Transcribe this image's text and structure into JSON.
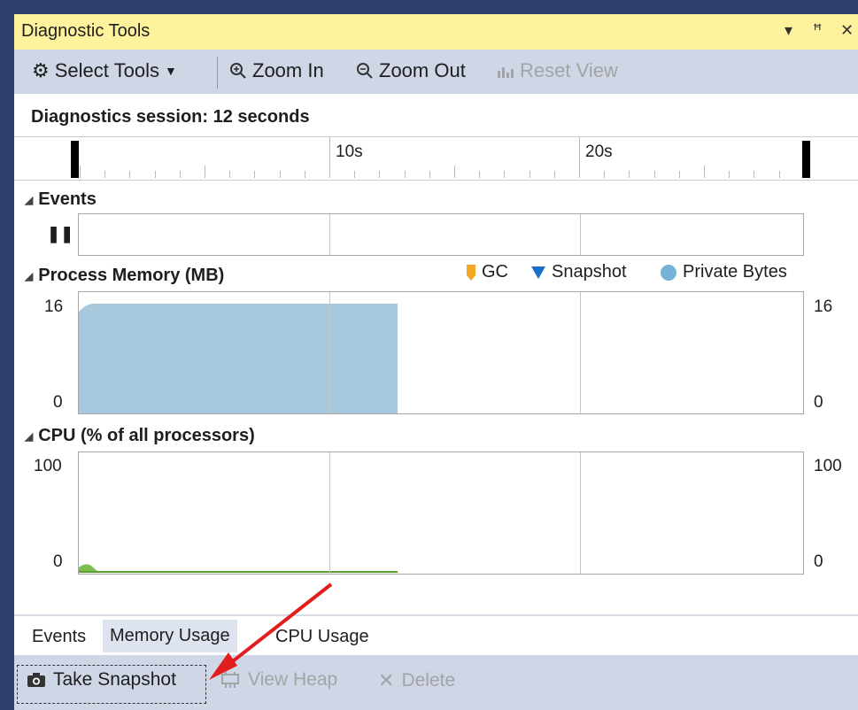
{
  "window": {
    "title": "Diagnostic Tools",
    "controls": [
      "▾",
      "ꟸ",
      "✕"
    ]
  },
  "toolbar": {
    "select_tools": "Select Tools",
    "zoom_in": "Zoom In",
    "zoom_out": "Zoom Out",
    "reset_view": "Reset View"
  },
  "session": {
    "label": "Diagnostics session: 12 seconds"
  },
  "ruler": {
    "labels": [
      "10s",
      "20s"
    ]
  },
  "events": {
    "title": "Events"
  },
  "memory": {
    "title": "Process Memory (MB)",
    "legend": [
      {
        "label": "GC",
        "color": "#f5a623",
        "icon": "gc-marker-icon"
      },
      {
        "label": "Snapshot",
        "color": "#1c6fc9",
        "icon": "snapshot-marker-icon"
      },
      {
        "label": "Private Bytes",
        "color": "#76b3d8",
        "icon": "private-bytes-dot-icon"
      }
    ],
    "y_max": "16",
    "y_min": "0",
    "fill_color": "#a8c9dd"
  },
  "cpu": {
    "title": "CPU (% of all processors)",
    "y_max": "100",
    "y_min": "0",
    "line_color": "#5aa02c"
  },
  "tabs": [
    "Events",
    "Memory Usage",
    "CPU Usage"
  ],
  "active_tab": "Memory Usage",
  "bottom": {
    "take_snapshot": "Take Snapshot",
    "view_heap": "View Heap",
    "delete": "Delete"
  },
  "annotation": {
    "arrow_color": "#e11d1d"
  }
}
